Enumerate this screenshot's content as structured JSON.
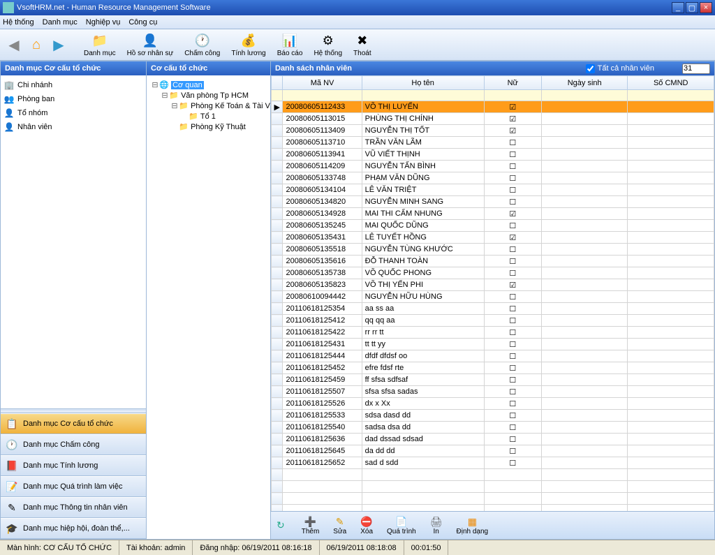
{
  "title": "VsoftHRM.net - Human Resource Management Software",
  "menu": [
    "Hệ thống",
    "Danh mục",
    "Nghiệp vụ",
    "Công cụ"
  ],
  "toolbar": [
    {
      "icon": "📁",
      "label": "Danh mục"
    },
    {
      "icon": "👤",
      "label": "Hồ sơ nhân sự"
    },
    {
      "icon": "🕐",
      "label": "Chấm công"
    },
    {
      "icon": "💰",
      "label": "Tính lương"
    },
    {
      "icon": "📊",
      "label": "Báo cáo"
    },
    {
      "icon": "⚙",
      "label": "Hệ thống"
    },
    {
      "icon": "✖",
      "label": "Thoát"
    }
  ],
  "left_panel_title": "Danh mục Cơ cấu tổ chức",
  "left_tree": [
    {
      "icon": "🏢",
      "label": "Chi nhánh"
    },
    {
      "icon": "👥",
      "label": "Phòng ban"
    },
    {
      "icon": "👤",
      "label": "Tổ nhóm"
    },
    {
      "icon": "👤",
      "label": "Nhân viên"
    }
  ],
  "sidenav": [
    {
      "icon": "📋",
      "label": "Danh mục Cơ cấu tổ chức",
      "active": true
    },
    {
      "icon": "🕐",
      "label": "Danh mục Chấm công"
    },
    {
      "icon": "📕",
      "label": "Danh mục Tính lương"
    },
    {
      "icon": "📝",
      "label": "Danh mục Quá trình làm việc"
    },
    {
      "icon": "✎",
      "label": "Danh mục Thông tin nhân viên"
    },
    {
      "icon": "🎓",
      "label": "Danh mục hiệp hội, đoàn thể,..."
    }
  ],
  "mid_panel_title": "Cơ cấu tổ chức",
  "org_tree": {
    "root": {
      "label": "Cơ quan",
      "children": [
        {
          "label": "Văn phòng Tp HCM",
          "children": [
            {
              "label": "Phòng Kế Toán & Tài Vụ",
              "children": [
                {
                  "label": "Tổ 1"
                }
              ]
            },
            {
              "label": "Phòng Kỹ Thuật"
            }
          ]
        }
      ]
    }
  },
  "right_panel_title": "Danh sách nhân viên",
  "all_emp_label": "Tất cả nhân viên",
  "count": "31",
  "columns": [
    "Mã NV",
    "Họ tên",
    "Nữ",
    "Ngày sinh",
    "Số CMND"
  ],
  "rows": [
    {
      "id": "20080605112433",
      "name": "VÕ THỊ LUYẾN",
      "f": true,
      "sel": true
    },
    {
      "id": "20080605113015",
      "name": "PHÙNG  THỊ CHÍNH",
      "f": true
    },
    {
      "id": "20080605113409",
      "name": "NGUYỄN THỊ   TỐT",
      "f": true
    },
    {
      "id": "20080605113710",
      "name": "TRẦN VĂN  LÃM",
      "f": false
    },
    {
      "id": "20080605113941",
      "name": "VŨ  VIẾT  THỊNH",
      "f": false
    },
    {
      "id": "20080605114209",
      "name": "NGUYỄN TẤN BÌNH",
      "f": false
    },
    {
      "id": "20080605133748",
      "name": "PHẠM VĂN DŨNG",
      "f": false
    },
    {
      "id": "20080605134104",
      "name": "LÊ VĂN TRIỆT",
      "f": false
    },
    {
      "id": "20080605134820",
      "name": "NGUYỄN MINH SANG",
      "f": false
    },
    {
      "id": "20080605134928",
      "name": "MAI THI CẨM NHUNG",
      "f": true
    },
    {
      "id": "20080605135245",
      "name": "MAI QUỐC DŨNG",
      "f": false
    },
    {
      "id": "20080605135431",
      "name": "LÊ TUYẾT HỒNG",
      "f": true
    },
    {
      "id": "20080605135518",
      "name": "NGUYỄN  TÙNG KHƯỚC",
      "f": false
    },
    {
      "id": "20080605135616",
      "name": "ĐỖ THANH TOÀN",
      "f": false
    },
    {
      "id": "20080605135738",
      "name": "VÕ QUỐC PHONG",
      "f": false
    },
    {
      "id": "20080605135823",
      "name": "VÕ THỊ YẾN PHI",
      "f": true
    },
    {
      "id": "20080610094442",
      "name": "NGUYỄN HỮU   HÙNG",
      "f": false
    },
    {
      "id": "20110618125354",
      "name": "aa ss aa",
      "f": false
    },
    {
      "id": "20110618125412",
      "name": "qq qq aa",
      "f": false
    },
    {
      "id": "20110618125422",
      "name": "rr rr tt",
      "f": false
    },
    {
      "id": "20110618125431",
      "name": "tt tt yy",
      "f": false
    },
    {
      "id": "20110618125444",
      "name": "dfdf dfdsf oo",
      "f": false
    },
    {
      "id": "20110618125452",
      "name": "efre fdsf rte",
      "f": false
    },
    {
      "id": "20110618125459",
      "name": "ff sfsa sdfsaf",
      "f": false
    },
    {
      "id": "20110618125507",
      "name": "sfsa sfsa sadas",
      "f": false
    },
    {
      "id": "20110618125526",
      "name": "dx x Xx",
      "f": false
    },
    {
      "id": "20110618125533",
      "name": "sdsa dasd dd",
      "f": false
    },
    {
      "id": "20110618125540",
      "name": "sadsa dsa dd",
      "f": false
    },
    {
      "id": "20110618125636",
      "name": "dad dssad sdsad",
      "f": false
    },
    {
      "id": "20110618125645",
      "name": "da dd dd",
      "f": false
    },
    {
      "id": "20110618125652",
      "name": "sad d sdd",
      "f": false
    }
  ],
  "btm": [
    {
      "ic": "➕",
      "lb": "Thêm",
      "c": "#2a8"
    },
    {
      "ic": "✎",
      "lb": "Sửa",
      "c": "#d90"
    },
    {
      "ic": "⛔",
      "lb": "Xóa",
      "c": "#c22"
    },
    {
      "ic": "📄",
      "lb": "Quá trình",
      "c": "#59c"
    },
    {
      "ic": "🖨",
      "lb": "In",
      "c": "#666"
    },
    {
      "ic": "▦",
      "lb": "Định dạng",
      "c": "#e80"
    }
  ],
  "status": {
    "screen": "Màn hình: CƠ CẤU TỔ CHỨC",
    "account": "Tài khoản: admin",
    "login": "Đăng nhập: 06/19/2011 08:16:18",
    "date": "06/19/2011 08:18:08",
    "elapsed": "00:01:50"
  }
}
